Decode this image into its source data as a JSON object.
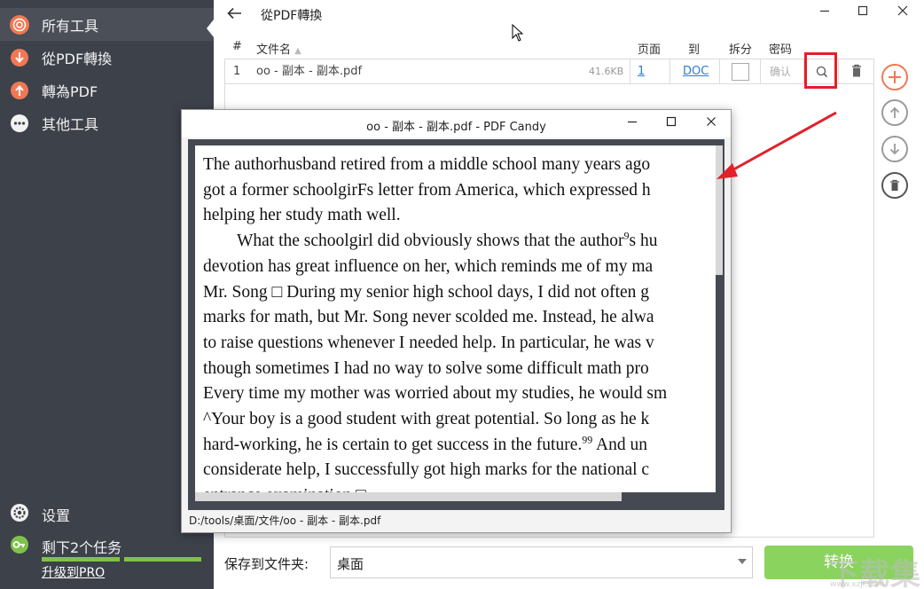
{
  "sidebar": {
    "items": [
      {
        "label": "所有工具",
        "icon": "all-tools-icon",
        "color": "#f07854"
      },
      {
        "label": "從PDF轉換",
        "icon": "from-pdf-icon",
        "color": "#f07854"
      },
      {
        "label": "轉為PDF",
        "icon": "to-pdf-icon",
        "color": "#f07854"
      },
      {
        "label": "其他工具",
        "icon": "more-tools-icon",
        "color": "#f2f2f2"
      }
    ],
    "settings_label": "设置",
    "tasks_label": "剩下2个任务",
    "tasks_progress": 0.94,
    "upgrade_label": "升级到PRO"
  },
  "window": {
    "title": "從PDF轉換",
    "back_icon": "back-arrow-icon",
    "controls": [
      "minimize-icon",
      "maximize-icon",
      "close-icon"
    ]
  },
  "table": {
    "headers": {
      "num": "#",
      "filename": "文件名",
      "pages": "页面",
      "to": "到",
      "split": "拆分",
      "password": "密码"
    },
    "rows": [
      {
        "num": "1",
        "filename": "oo - 副本 - 副本.pdf",
        "size": "41.6KB",
        "pages": "1",
        "format": "DOC",
        "password_placeholder": "确认"
      }
    ]
  },
  "actions": {
    "add_icon": "plus-icon",
    "up_icon": "arrow-up-icon",
    "down_icon": "arrow-down-icon",
    "delete_icon": "trash-icon",
    "accent": "#f07854"
  },
  "footer": {
    "save_label": "保存到文件夹:",
    "folder_value": "桌面",
    "convert_label": "转换",
    "convert_color": "#8ad35f"
  },
  "preview": {
    "title": "oo - 副本 - 副本.pdf - PDF Candy",
    "lines": [
      "The authorhusband retired from a middle school many years ago",
      "got a former schoolgirFs letter from America, which expressed h",
      "helping her study math well.",
      "What the schoolgirl did obviously shows that the author",
      "devotion has great influence on her, which reminds me of my ma",
      "Mr. Song □   During my senior high school days, I did not often g",
      "marks for math, but Mr. Song never scolded me. Instead, he alwa",
      "to raise questions whenever I needed help. In particular, he was v",
      "though sometimes I had no way to solve some difficult math pro",
      "Every time my mother was worried about my studies, he would sm",
      "^Your boy is a good student with great potential. So long as he k",
      "hard-working, he is certain to get success in the future.",
      "considerate help, I successfully got high marks for the national c",
      "entrance examination.□"
    ],
    "line4_sup": "9",
    "line4_tail": "s hu",
    "line12_sup": "99",
    "line12_tail": " And un",
    "path": "D:/tools/桌面/文件/oo - 副本 - 副本.pdf"
  },
  "watermark": {
    "text": "下载集",
    "sub": "www.xzji.com"
  }
}
